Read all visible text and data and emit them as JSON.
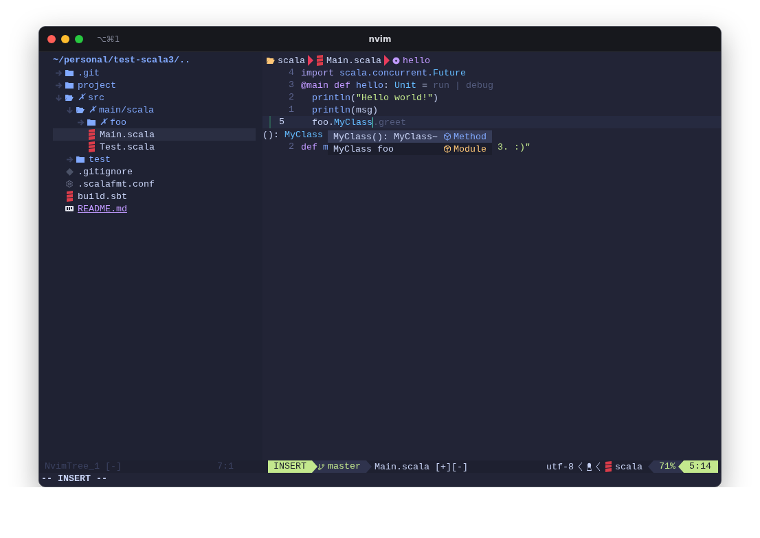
{
  "window": {
    "title": "nvim",
    "shortcut": "⌥⌘1"
  },
  "file_tree": {
    "root": "~/personal/test-scala3/..",
    "items": [
      {
        "name": ".git",
        "kind": "folder",
        "expanded": false,
        "selected": false
      },
      {
        "name": "project",
        "kind": "folder",
        "expanded": false,
        "selected": false
      },
      {
        "name": "src",
        "kind": "folder",
        "expanded": true,
        "status": "✗",
        "selected": false,
        "children": [
          {
            "name": "main/scala",
            "kind": "folder",
            "expanded": true,
            "status": "✗",
            "selected": false,
            "children": [
              {
                "name": "foo",
                "kind": "folder",
                "expanded": false,
                "status": "✗",
                "selected": false
              },
              {
                "name": "Main.scala",
                "kind": "scala",
                "selected": true
              },
              {
                "name": "Test.scala",
                "kind": "scala",
                "selected": false
              }
            ]
          },
          {
            "name": "test",
            "kind": "folder",
            "expanded": false,
            "selected": false
          }
        ]
      },
      {
        "name": ".gitignore",
        "kind": "git",
        "selected": false
      },
      {
        "name": ".scalafmt.conf",
        "kind": "gear",
        "selected": false
      },
      {
        "name": "build.sbt",
        "kind": "scala",
        "selected": false
      },
      {
        "name": "README.md",
        "kind": "markdown",
        "selected": false,
        "special": true
      }
    ]
  },
  "editor": {
    "breadcrumb": [
      {
        "kind": "folder",
        "text": "scala"
      },
      {
        "kind": "scala",
        "text": "Main.scala"
      },
      {
        "kind": "function",
        "text": "hello"
      }
    ],
    "lines": [
      {
        "kind": "code",
        "number": "4",
        "current": false,
        "indented": false,
        "tokens": [
          {
            "kind": "import",
            "text": "import "
          },
          {
            "kind": "namespace",
            "text": "scala.concurrent."
          },
          {
            "kind": "type",
            "text": "Future"
          }
        ]
      },
      {
        "kind": "code",
        "number": "3",
        "current": false,
        "indented": false,
        "tokens": [
          {
            "kind": "keyword",
            "text": "@main "
          },
          {
            "kind": "keyword",
            "text": "def "
          },
          {
            "kind": "function",
            "text": "hello"
          },
          {
            "kind": "plain",
            "text": ": "
          },
          {
            "kind": "type",
            "text": "Unit"
          },
          {
            "kind": "plain",
            "text": " = "
          },
          {
            "kind": "dim",
            "text": "run | debug"
          }
        ]
      },
      {
        "kind": "code",
        "number": "2",
        "current": false,
        "indented": true,
        "tokens": [
          {
            "kind": "function",
            "text": "println"
          },
          {
            "kind": "plain",
            "text": "("
          },
          {
            "kind": "string",
            "text": "\"Hello world!\""
          },
          {
            "kind": "plain",
            "text": ")"
          }
        ]
      },
      {
        "kind": "code",
        "number": "1",
        "current": false,
        "indented": true,
        "tokens": [
          {
            "kind": "function",
            "text": "println"
          },
          {
            "kind": "plain",
            "text": "(msg)"
          }
        ]
      },
      {
        "kind": "code",
        "number": "5",
        "current": true,
        "indented": true,
        "tokens": [
          {
            "kind": "plain",
            "text": "foo."
          },
          {
            "kind": "type",
            "text": "MyClass",
            "cursor": true
          },
          {
            "kind": "dim",
            "text": ".greet"
          }
        ]
      },
      {
        "kind": "hint",
        "tokens": [
          {
            "kind": "plain",
            "text": "(): "
          },
          {
            "kind": "type",
            "text": "MyClass"
          }
        ]
      },
      {
        "kind": "code",
        "number": "2",
        "current": false,
        "indented": false,
        "tokens": [
          {
            "kind": "keyword",
            "text": "def "
          },
          {
            "kind": "function",
            "text": "m"
          },
          {
            "kind": "string_tail",
            "text": "3. :)\""
          }
        ]
      }
    ],
    "completion": [
      {
        "label": "MyClass(): MyClass~",
        "kind": "method",
        "kind_label": "Method",
        "selected": true
      },
      {
        "label": "MyClass foo",
        "kind": "module",
        "kind_label": "Module",
        "selected": false
      }
    ]
  },
  "status_bar": {
    "tree_name": "NvimTree_1 [-]",
    "tree_position": "7:1",
    "mode": "INSERT",
    "branch": "master",
    "file": "Main.scala [+][-]",
    "encoding": "utf-8",
    "filetype": "scala",
    "percent": "71%",
    "position": "5:14"
  },
  "command_line": "-- INSERT --"
}
